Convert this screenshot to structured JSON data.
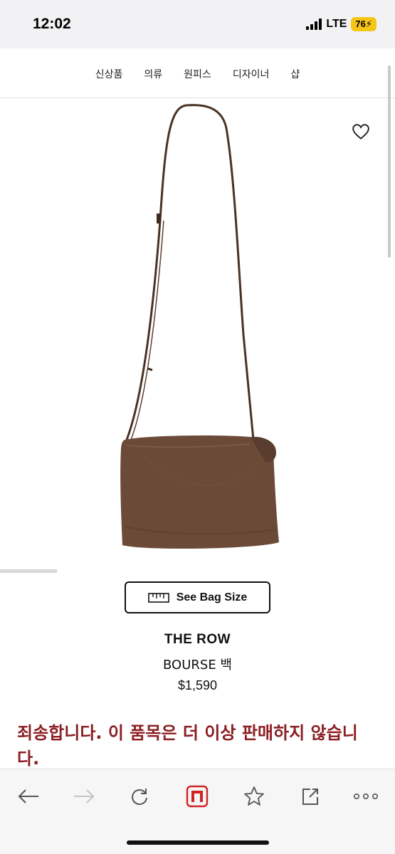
{
  "status": {
    "time": "12:02",
    "network": "LTE",
    "battery": "76"
  },
  "nav": {
    "items": [
      "신상품",
      "의류",
      "원피스",
      "디자이너",
      "샵"
    ]
  },
  "product": {
    "size_button": "See Bag Size",
    "brand": "THE ROW",
    "name": "BOURSE 백",
    "price": "$1,590",
    "sold_out_message": "죄송합니다. 이 품목은 더 이상 판매하지 않습니다."
  },
  "colors": {
    "accent_text": "#8b1e22",
    "bag_brown": "#6b4a38",
    "battery": "#f5c518",
    "tab_icon": "#d32222"
  },
  "toolbar": {
    "icons": [
      "back-arrow-icon",
      "forward-arrow-icon",
      "reload-icon",
      "naver-tab-icon",
      "star-icon",
      "share-icon",
      "more-icon"
    ]
  }
}
